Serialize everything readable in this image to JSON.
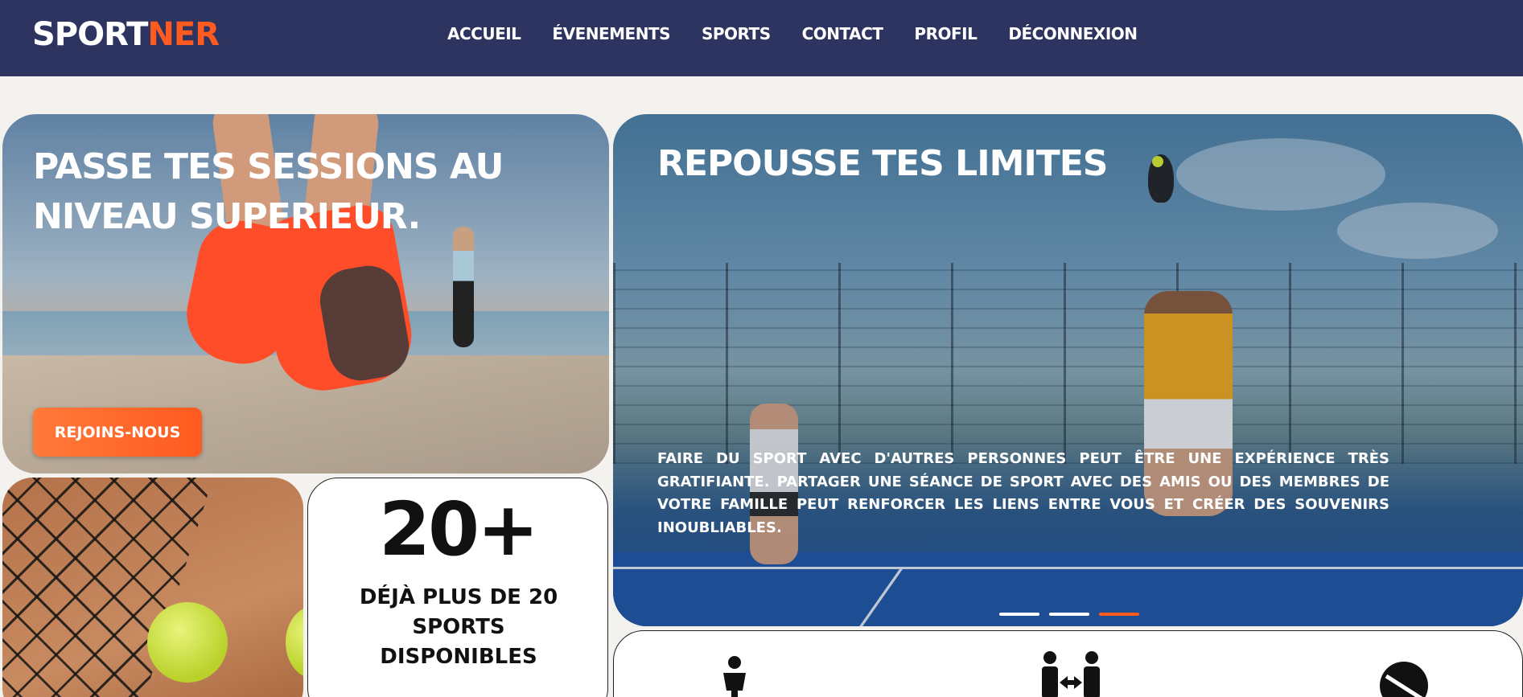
{
  "brand": {
    "part1": "SPORT",
    "part2": "NER",
    "accent": "#ff5a1f",
    "navy": "#2c345f"
  },
  "nav": {
    "items": [
      "ACCUEIL",
      "ÉVENEMENTS",
      "SPORTS",
      "CONTACT",
      "PROFIL",
      "DÉCONNEXION"
    ]
  },
  "hero_left": {
    "title": "PASSE TES SESSIONS AU NIVEAU SUPERIEUR.",
    "cta_label": "REJOINS-NOUS"
  },
  "hero_right": {
    "title": "REPOUSSE TES LIMITES",
    "text": "FAIRE DU SPORT AVEC D'AUTRES PERSONNES PEUT ÊTRE UNE EXPÉRIENCE TRÈS GRATIFIANTE. PARTAGER UNE SÉANCE DE SPORT AVEC DES AMIS OU DES MEMBRES DE VOTRE FAMILLE PEUT RENFORCER LES LIENS ENTRE VOUS ET CRÉER DES SOUVENIRS INOUBLIABLES.",
    "carousel_active_index": 2,
    "carousel_count": 3
  },
  "stats": {
    "number": "20+",
    "label": "DÉJÀ PLUS DE 20 SPORTS DISPONIBLES"
  },
  "features": {
    "icons": [
      "person-icon",
      "people-exchange-icon",
      "no-ball-icon"
    ]
  }
}
